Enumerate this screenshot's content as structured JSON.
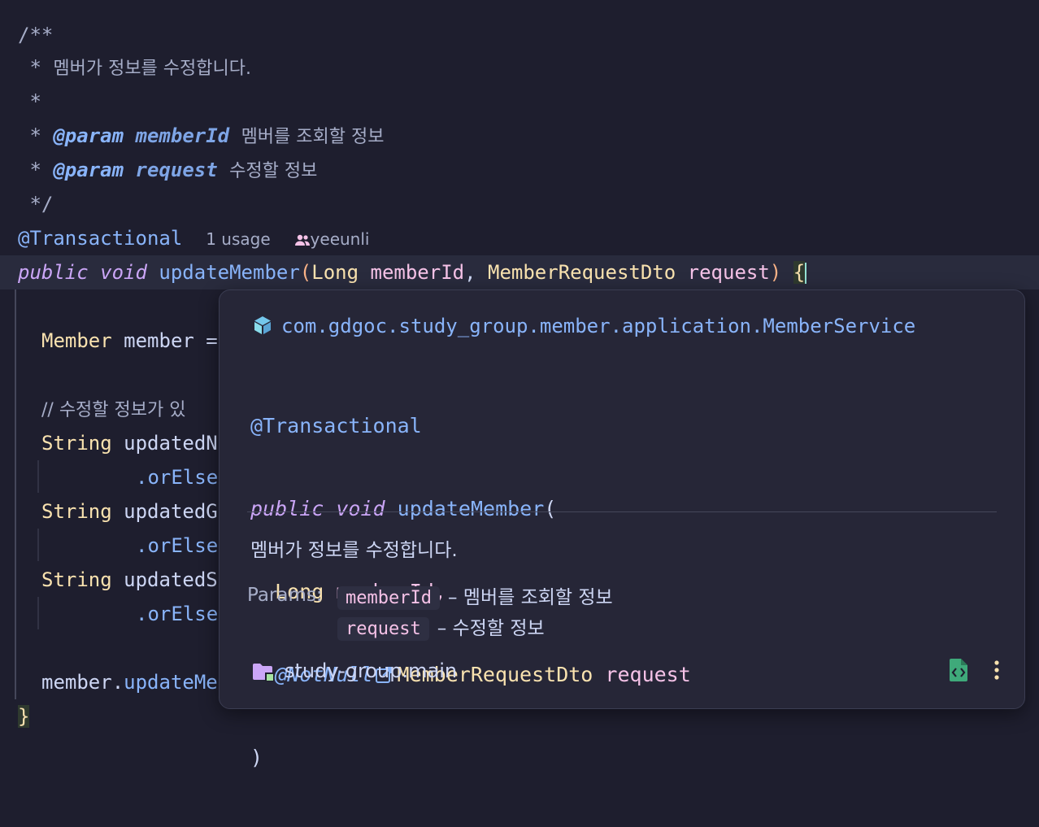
{
  "doc": {
    "open": "/**",
    "star": " *",
    "close": " */",
    "description": "멤버가 정보를 수정합니다.",
    "param_tag": "@param",
    "params": [
      {
        "name": "memberId",
        "desc": "멤버를 조회할 정보"
      },
      {
        "name": "request",
        "desc": "수정할 정보"
      }
    ]
  },
  "annotation_line": {
    "annotation": "@Transactional",
    "usages": "1 usage",
    "author": "yeeunli"
  },
  "signature": {
    "kw_public": "public",
    "kw_void": "void",
    "method": "updateMember",
    "open_paren": "(",
    "type1": "Long",
    "param1": "memberId",
    "comma": ",",
    "type2": "MemberRequestDto",
    "param2": "request",
    "close_paren": ")",
    "brace": "{"
  },
  "body": {
    "line1_type": "Member",
    "line1_rest": " member =",
    "comment": "// 수정할 정보가 있",
    "str_type": "String",
    "var1": " updatedN",
    "var2": " updatedG",
    "var3": " updatedS",
    "or_else": ".orElse",
    "last_obj": "member.",
    "last_call": "updateMe",
    "closing": "}"
  },
  "popup": {
    "fqcn": "com.gdgoc.study_group.member.application.MemberService",
    "annotation": "@Transactional",
    "kw_public": "public",
    "kw_void": "void",
    "method": "updateMember",
    "open_paren": "(",
    "type1": "Long",
    "param1": "memberId,",
    "notnull": "@NotNull",
    "type2": "MemberRequestDto",
    "param2": "request",
    "close_paren": ")",
    "description": "멤버가 정보를 수정합니다.",
    "params_label": "Params:",
    "params": [
      {
        "name": "memberId",
        "desc": "– 멤버를 조회할 정보"
      },
      {
        "name": "request",
        "desc": "– 수정할 정보"
      }
    ],
    "module": "study-group.main"
  },
  "colors": {
    "background": "#1e1e2e",
    "keyword": "#cba6f7",
    "function": "#89b4fa",
    "type": "#f9e2af",
    "param": "#f5c2e7",
    "popup_bg": "#262637"
  }
}
